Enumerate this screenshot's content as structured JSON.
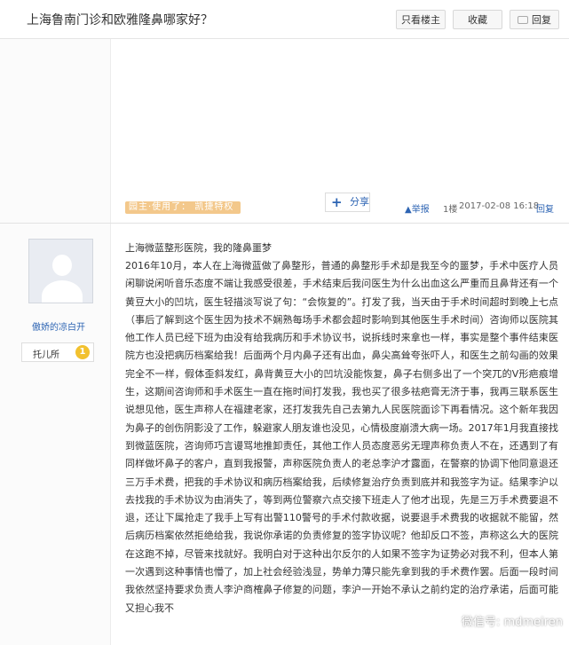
{
  "header": {
    "title": "上海鲁南门诊和欧雅隆鼻哪家好？",
    "only_host_label": "只看楼主",
    "favorite_label": "收藏",
    "reply_label": "回复"
  },
  "post_upper": {
    "share_label": "分享",
    "tags_text": "园主·使用了：  凯捷特权",
    "report_label": "举报",
    "floor": "1楼",
    "timestamp": "2017-02-08 16:18",
    "reply_label": "回复"
  },
  "author": {
    "name": "傲娇的凉白开",
    "tag_label": "托儿所",
    "level": "1"
  },
  "post": {
    "subject": "上海微蓝整形医院，我的隆鼻噩梦",
    "body": "2016年10月，本人在上海微蓝做了鼻整形，普通的鼻整形手术却是我至今的噩梦，手术中医疗人员闲聊说闲听音乐态度不端让我感受很差，手术结束后我问医生为什么出血这么严重而且鼻背还有一个黄豆大小的凹坑，医生轻描淡写说了句：“会恢复的”。打发了我，当天由于手术时间超时到晚上七点（事后了解到这个医生因为技术不娴熟每场手术都会超时影响到其他医生手术时间）咨询师以医院其他工作人员已经下班为由没有给我病历和手术协议书，说拆线时来拿也一样，事实是整个事件结束医院方也没把病历档案给我！后面两个月内鼻子还有出血，鼻尖高耸夸张吓人，和医生之前勾画的效果完全不一样，假体歪斜发红，鼻背黄豆大小的凹坑没能恢复，鼻子右侧多出了一个突兀的V形疤痕增生，这期间咨询师和手术医生一直在拖时间打发我，我也买了很多祛疤膏无济于事，我再三联系医生说想见他，医生声称人在福建老家，还打发我先自己去第九人民医院面诊下再看情况。这个新年我因为鼻子的创伤阴影没了工作，躲避家人朋友谁也没见，心情极度崩溃大病一场。2017年1月我直接找到微蓝医院，咨询师巧言谩骂地推卸责任，其他工作人员态度恶劣无理声称负责人不在，还遇到了有同样做坏鼻子的客户，直到我报警，声称医院负责人的老总李沪才露面，在警察的协调下他同意退还三万手术费，把我的手术协议和病历档案给我，后续修复治疗负责到底并和我签字为证。结果李沪以去找我的手术协议为由消失了，等到两位警察六点交接下班走人了他才出现，先是三万手术费要退不退，还让下属抢走了我手上写有出警110警号的手术付款收据，说要退手术费我的收据就不能留，然后病历档案依然拒绝给我，我说你承诺的负责修复的签字协议呢？他却反口不签，声称这么大的医院在这跑不掉，尽管来找就好。我明白对于这种出尔反尔的人如果不签字为证势必对我不利，但本人第一次遇到这种事情也懵了，加上社会经验浅显，势单力薄只能先拿到我的手术费作罢。后面一段时间我依然坚持要求负责人李沪商榷鼻子修复的问题，李沪一开始不承认之前约定的治疗承诺，后面可能又担心我不"
  },
  "watermark": "微信号: mdmeiren"
}
